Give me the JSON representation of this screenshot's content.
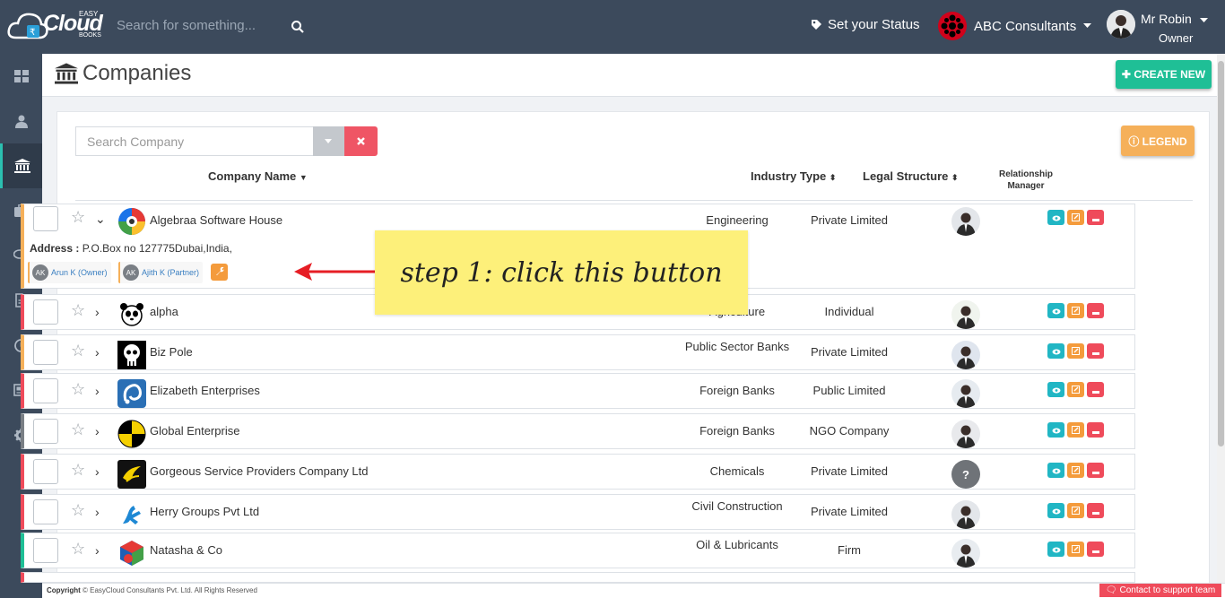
{
  "app": {
    "logo_word": "Cloud",
    "logo_easy": "EASY",
    "logo_books": "BOOKS"
  },
  "topbar": {
    "search_placeholder": "Search for something...",
    "status_label": "Set your Status",
    "company": "ABC Consultants",
    "user_name": "Mr Robin",
    "user_role": "Owner"
  },
  "sidebar": {
    "items": [
      {
        "icon": "dashboard-icon"
      },
      {
        "icon": "user-icon"
      },
      {
        "icon": "bank-icon",
        "active": true
      },
      {
        "icon": "briefcase-icon"
      },
      {
        "icon": "chat-icon"
      },
      {
        "icon": "document-icon"
      },
      {
        "icon": "clock-icon"
      },
      {
        "icon": "newspaper-icon"
      },
      {
        "icon": "gear-icon"
      }
    ]
  },
  "page": {
    "title": "Companies",
    "create_label": "CREATE NEW",
    "search_placeholder": "Search Company",
    "legend_label": "LEGEND"
  },
  "table": {
    "headers": {
      "name": "Company Name",
      "industry": "Industry Type",
      "legal": "Legal Structure",
      "rm_line1": "Relationship",
      "rm_line2": "Manager"
    },
    "rows": [
      {
        "name": "Algebraa Software House",
        "industry": "Engineering",
        "legal": "Private Limited",
        "color": "#f5b05a",
        "expanded": true
      },
      {
        "name": "alpha",
        "industry": "Agriculture",
        "legal": "Individual",
        "color": "#ef4b5b"
      },
      {
        "name": "Biz Pole",
        "industry": "Public Sector Banks",
        "legal": "Private Limited",
        "color": "#f5b05a"
      },
      {
        "name": "Elizabeth Enterprises",
        "industry": "Foreign Banks",
        "legal": "Public Limited",
        "color": "#ef4b5b"
      },
      {
        "name": "Global Enterprise",
        "industry": "Foreign Banks",
        "legal": "NGO Company",
        "color": "#7a7f85"
      },
      {
        "name": "Gorgeous Service Providers Company Ltd",
        "industry": "Chemicals",
        "legal": "Private Limited",
        "color": "#ef4b5b"
      },
      {
        "name": "Herry Groups Pvt Ltd",
        "industry": "Civil Construction",
        "legal": "Private Limited",
        "color": "#ef4b5b"
      },
      {
        "name": "Natasha & Co",
        "industry": "Oil & Lubricants",
        "legal": "Firm",
        "color": "#1fbf96"
      }
    ],
    "expanded": {
      "address_label": "Address :",
      "address_value": "P.O.Box no 127775Dubai,India,",
      "contacts": [
        {
          "initials": "AK",
          "label": "Arun K (Owner)"
        },
        {
          "initials": "AK",
          "label": "Ajith K (Partner)"
        }
      ]
    }
  },
  "annotation": {
    "callout": "step 1: click this button"
  },
  "footer": {
    "copyright_bold": "Copyright",
    "copyright_text": "© EasyCloud Consultants Pvt. Ltd. All Rights Reserved",
    "support": "Contact to support team"
  }
}
